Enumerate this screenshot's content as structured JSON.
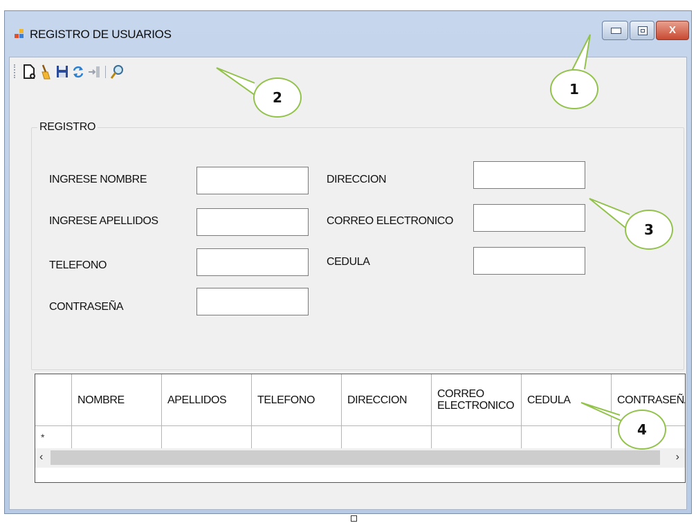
{
  "window": {
    "title": "REGISTRO DE USUARIOS",
    "close_glyph": "X"
  },
  "toolbar": {
    "buttons": [
      {
        "icon": "new-document-icon"
      },
      {
        "icon": "clean-broom-icon"
      },
      {
        "icon": "save-disk-icon"
      },
      {
        "icon": "refresh-arrows-icon"
      },
      {
        "icon": "exit-door-icon"
      },
      {
        "icon": "search-magnifier-icon"
      }
    ]
  },
  "form": {
    "group_title": "REGISTRO",
    "fields": {
      "nombre": {
        "label": "INGRESE NOMBRE",
        "value": ""
      },
      "apellidos": {
        "label": "INGRESE APELLIDOS",
        "value": ""
      },
      "telefono": {
        "label": "TELEFONO",
        "value": ""
      },
      "contrasena": {
        "label": "CONTRASEÑA",
        "value": ""
      },
      "direccion": {
        "label": "DIRECCION",
        "value": ""
      },
      "correo": {
        "label": "CORREO ELECTRONICO",
        "value": ""
      },
      "cedula": {
        "label": "CEDULA",
        "value": ""
      }
    }
  },
  "grid": {
    "columns": [
      "NOMBRE",
      "APELLIDOS",
      "TELEFONO",
      "DIRECCION",
      "CORREO ELECTRONICO",
      "CEDULA",
      "CONTRASEÑA"
    ],
    "new_row_marker": "*",
    "scroll_left": "‹",
    "scroll_right": "›"
  },
  "callouts": [
    "1",
    "2",
    "3",
    "4"
  ],
  "colors": {
    "callout_border": "#92c24a",
    "close_button": "#c84a32"
  }
}
